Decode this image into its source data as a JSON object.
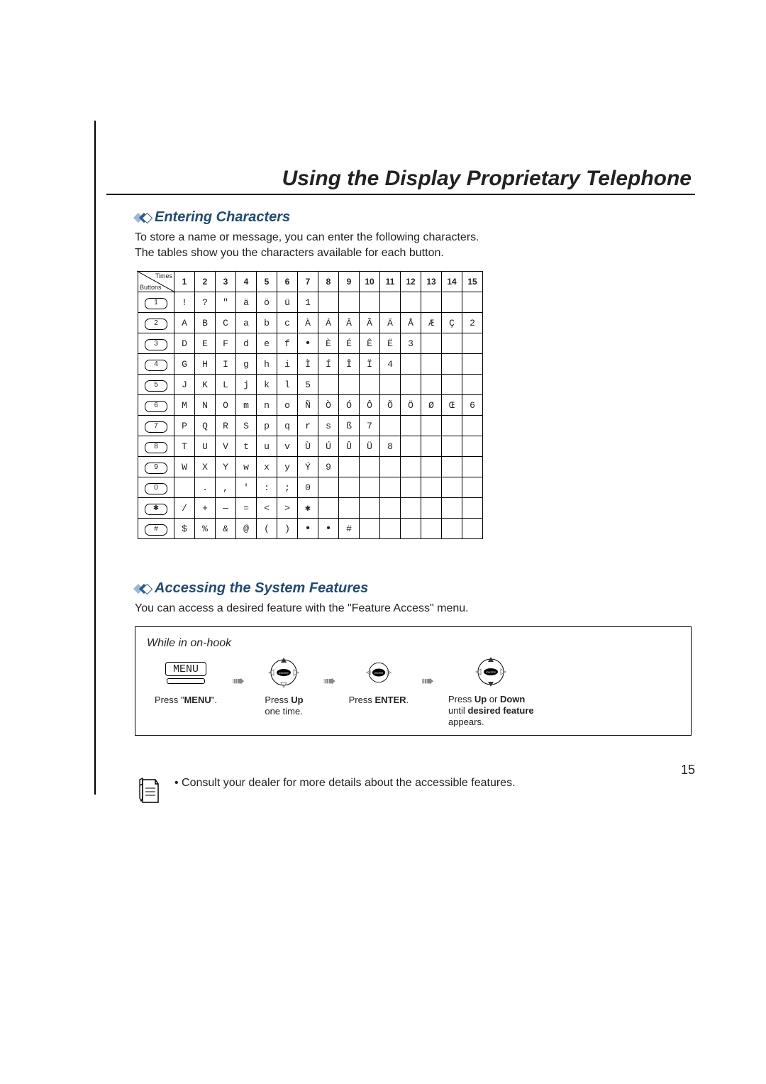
{
  "title": "Using the Display Proprietary Telephone",
  "section1": {
    "heading": "Entering Characters",
    "paragraph": "To store a name or message, you can enter the following characters.\nThe tables show you the characters available for each button."
  },
  "table_corner": {
    "top": "Times",
    "bottom": "Buttons"
  },
  "columns": [
    "1",
    "2",
    "3",
    "4",
    "5",
    "6",
    "7",
    "8",
    "9",
    "10",
    "11",
    "12",
    "13",
    "14",
    "15"
  ],
  "rows": [
    {
      "key": "1",
      "cells": [
        "!",
        "?",
        "\"",
        "ä",
        "ö",
        "ü",
        "1",
        "",
        "",
        "",
        "",
        "",
        "",
        "",
        ""
      ]
    },
    {
      "key": "2",
      "cells": [
        "A",
        "B",
        "C",
        "a",
        "b",
        "c",
        "À",
        "Á",
        "Â",
        "Ã",
        "Ä",
        "Å",
        "Æ",
        "Ç",
        "2"
      ]
    },
    {
      "key": "3",
      "cells": [
        "D",
        "E",
        "F",
        "d",
        "e",
        "f",
        "•",
        "È",
        "É",
        "Ê",
        "Ë",
        "3",
        "",
        "",
        ""
      ]
    },
    {
      "key": "4",
      "cells": [
        "G",
        "H",
        "I",
        "g",
        "h",
        "i",
        "Ì",
        "Í",
        "Î",
        "Ï",
        "4",
        "",
        "",
        "",
        ""
      ]
    },
    {
      "key": "5",
      "cells": [
        "J",
        "K",
        "L",
        "j",
        "k",
        "l",
        "5",
        "",
        "",
        "",
        "",
        "",
        "",
        "",
        ""
      ]
    },
    {
      "key": "6",
      "cells": [
        "M",
        "N",
        "O",
        "m",
        "n",
        "o",
        "Ñ",
        "Ò",
        "Ó",
        "Ô",
        "Õ",
        "Ö",
        "Ø",
        "Œ",
        "6"
      ]
    },
    {
      "key": "7",
      "cells": [
        "P",
        "Q",
        "R",
        "S",
        "p",
        "q",
        "r",
        "s",
        "ß",
        "7",
        "",
        "",
        "",
        "",
        ""
      ]
    },
    {
      "key": "8",
      "cells": [
        "T",
        "U",
        "V",
        "t",
        "u",
        "v",
        "Ù",
        "Ú",
        "Û",
        "Ü",
        "8",
        "",
        "",
        "",
        ""
      ]
    },
    {
      "key": "9",
      "cells": [
        "W",
        "X",
        "Y",
        "w",
        "x",
        "y",
        "Ý",
        "9",
        "",
        "",
        "",
        "",
        "",
        "",
        ""
      ]
    },
    {
      "key": "0",
      "cells": [
        "",
        ".",
        ",",
        "'",
        ":",
        ";",
        "0",
        "",
        "",
        "",
        "",
        "",
        "",
        "",
        ""
      ]
    },
    {
      "key": "✱",
      "cells": [
        "/",
        "+",
        "—",
        "=",
        "<",
        ">",
        "✱",
        "",
        "",
        "",
        "",
        "",
        "",
        "",
        ""
      ]
    },
    {
      "key": "#",
      "cells": [
        "$",
        "%",
        "&",
        "@",
        "(",
        ")",
        "•",
        "•",
        "#",
        "",
        "",
        "",
        "",
        "",
        ""
      ]
    }
  ],
  "section2": {
    "heading": "Accessing the System Features",
    "paragraph": "You can access a desired feature with the \"Feature Access\" menu."
  },
  "steps": {
    "box": "While in on-hook",
    "menu_label": "MENU",
    "s1": "Press \"<b>MENU</b>\".",
    "s2": "Press <b>Up</b><br>one time.",
    "s3": "Press <b>ENTER</b>.",
    "s4": "Press <b>Up</b> or <b>Down</b><br>until <b>desired feature</b><br>appears."
  },
  "note": "• Consult your dealer for more details about the accessible features.",
  "pagenum": "15",
  "chart_data": {
    "type": "table",
    "title": "Character entry map: button × press-count",
    "columns_label": "Times (press count)",
    "rows_label": "Buttons",
    "columns": [
      "1",
      "2",
      "3",
      "4",
      "5",
      "6",
      "7",
      "8",
      "9",
      "10",
      "11",
      "12",
      "13",
      "14",
      "15"
    ],
    "row_keys": [
      "1",
      "2",
      "3",
      "4",
      "5",
      "6",
      "7",
      "8",
      "9",
      "0",
      "*",
      "#"
    ],
    "cells": [
      [
        "!",
        "?",
        "\"",
        "ä",
        "ö",
        "ü",
        "1",
        "",
        "",
        "",
        "",
        "",
        "",
        "",
        ""
      ],
      [
        "A",
        "B",
        "C",
        "a",
        "b",
        "c",
        "À",
        "Á",
        "Â",
        "Ã",
        "Ä",
        "Å",
        "Æ",
        "Ç",
        "2"
      ],
      [
        "D",
        "E",
        "F",
        "d",
        "e",
        "f",
        "•",
        "È",
        "É",
        "Ê",
        "Ë",
        "3",
        "",
        "",
        ""
      ],
      [
        "G",
        "H",
        "I",
        "g",
        "h",
        "i",
        "Ì",
        "Í",
        "Î",
        "Ï",
        "4",
        "",
        "",
        "",
        ""
      ],
      [
        "J",
        "K",
        "L",
        "j",
        "k",
        "l",
        "5",
        "",
        "",
        "",
        "",
        "",
        "",
        "",
        ""
      ],
      [
        "M",
        "N",
        "O",
        "m",
        "n",
        "o",
        "Ñ",
        "Ò",
        "Ó",
        "Ô",
        "Õ",
        "Ö",
        "Ø",
        "Œ",
        "6"
      ],
      [
        "P",
        "Q",
        "R",
        "S",
        "p",
        "q",
        "r",
        "s",
        "ß",
        "7",
        "",
        "",
        "",
        "",
        ""
      ],
      [
        "T",
        "U",
        "V",
        "t",
        "u",
        "v",
        "Ù",
        "Ú",
        "Û",
        "Ü",
        "8",
        "",
        "",
        "",
        ""
      ],
      [
        "W",
        "X",
        "Y",
        "w",
        "x",
        "y",
        "Ý",
        "9",
        "",
        "",
        "",
        "",
        "",
        "",
        ""
      ],
      [
        "",
        ".",
        ",",
        "'",
        ":",
        ";",
        "0",
        "",
        "",
        "",
        "",
        "",
        "",
        "",
        ""
      ],
      [
        "/",
        "+",
        "—",
        "=",
        "<",
        ">",
        "*",
        "",
        "",
        "",
        "",
        "",
        "",
        "",
        ""
      ],
      [
        "$",
        "%",
        "&",
        "@",
        "(",
        ")",
        "•",
        "•",
        "#",
        "",
        "",
        "",
        "",
        "",
        ""
      ]
    ]
  }
}
